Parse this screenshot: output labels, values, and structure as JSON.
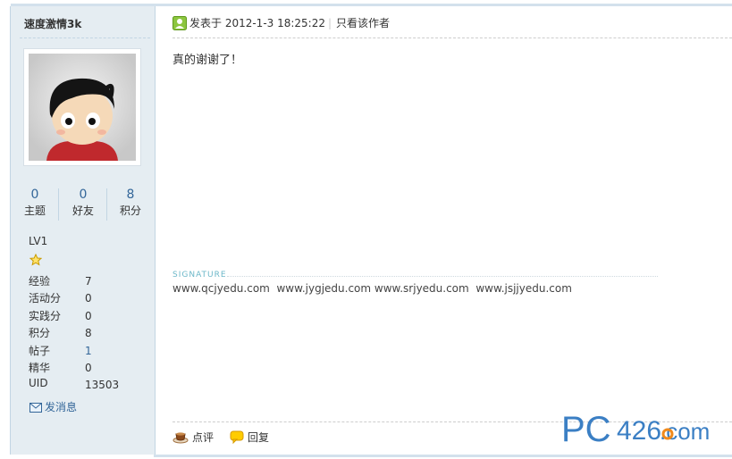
{
  "sidebar": {
    "username": "速度激情3k",
    "stats": [
      {
        "value": "0",
        "label": "主题"
      },
      {
        "value": "0",
        "label": "好友"
      },
      {
        "value": "8",
        "label": "积分"
      }
    ],
    "level": "LV1",
    "info": [
      {
        "key": "经验",
        "value": "7"
      },
      {
        "key": "活动分",
        "value": "0"
      },
      {
        "key": "实践分",
        "value": "0"
      },
      {
        "key": "积分",
        "value": "8"
      },
      {
        "key": "帖子",
        "value": "1"
      },
      {
        "key": "精华",
        "value": "0"
      },
      {
        "key": "UID",
        "value": "13503"
      }
    ],
    "send_message": "发消息"
  },
  "post": {
    "date_label": "发表于 2012-1-3 18:25:22",
    "pipe": "|",
    "author_only": "只看该作者",
    "body": "真的谢谢了！",
    "signature_label": "SIGNATURE",
    "signature": "www.qcjyedu.com  www.jygjedu.com www.srjyedu.com  www.jsjjyedu.com"
  },
  "actions": {
    "comment": "点评",
    "reply": "回复"
  },
  "watermark": {
    "text_left": "PC",
    "text_mid": "426",
    "text_right": ".com"
  },
  "colors": {
    "sidebar_bg": "#e5edf2",
    "link": "#336699",
    "signature_label": "#6cb7c8",
    "watermark_blue": "#3b7fc4",
    "watermark_orange": "#f08a1c"
  }
}
